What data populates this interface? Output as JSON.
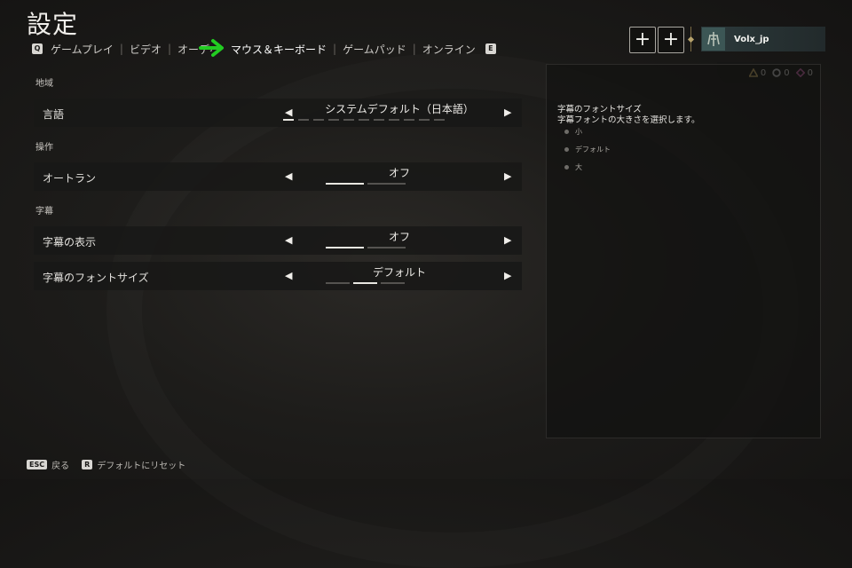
{
  "page": {
    "title": "設定"
  },
  "tabs": {
    "left_key": "Q",
    "right_key": "E",
    "items": [
      {
        "label": "ゲームプレイ"
      },
      {
        "label": "ビデオ"
      },
      {
        "label": "オーディオ"
      },
      {
        "label": "マウス＆キーボード"
      },
      {
        "label": "ゲームパッド"
      },
      {
        "label": "オンライン"
      }
    ],
    "active_index": 3
  },
  "header": {
    "add_label_1": "+",
    "add_label_2": "+",
    "username": "Volx_jp"
  },
  "currency": [
    {
      "icon": "triangle-icon",
      "value": "0",
      "color": "#d3b56a"
    },
    {
      "icon": "coin-icon",
      "value": "0",
      "color": "#c9c9c9"
    },
    {
      "icon": "diamond-icon",
      "value": "0",
      "color": "#d46ab0"
    }
  ],
  "sections": {
    "region": "地域",
    "controls": "操作",
    "subtitles": "字幕"
  },
  "settings": {
    "language": {
      "label": "言語",
      "value": "システムデフォルト（日本語）",
      "selected": 0,
      "count": 11
    },
    "autorun": {
      "label": "オートラン",
      "value": "オフ",
      "selected": 0,
      "count": 2
    },
    "subtitle_display": {
      "label": "字幕の表示",
      "value": "オフ",
      "selected": 0,
      "count": 2
    },
    "subtitle_font_size": {
      "label": "字幕のフォントサイズ",
      "value": "デフォルト",
      "selected": 1,
      "count": 3
    }
  },
  "arrows": {
    "left": "◀",
    "right": "▶"
  },
  "description": {
    "title": "字幕のフォントサイズ",
    "text": "字幕フォントの大きさを選択します。",
    "options": [
      "小",
      "デフォルト",
      "大"
    ]
  },
  "footer": {
    "back_key": "ESC",
    "back_label": "戻る",
    "reset_key": "R",
    "reset_label": "デフォルトにリセット"
  },
  "colors": {
    "annotation_arrow": "#22cc22",
    "accent_gold": "#b9a46d"
  }
}
